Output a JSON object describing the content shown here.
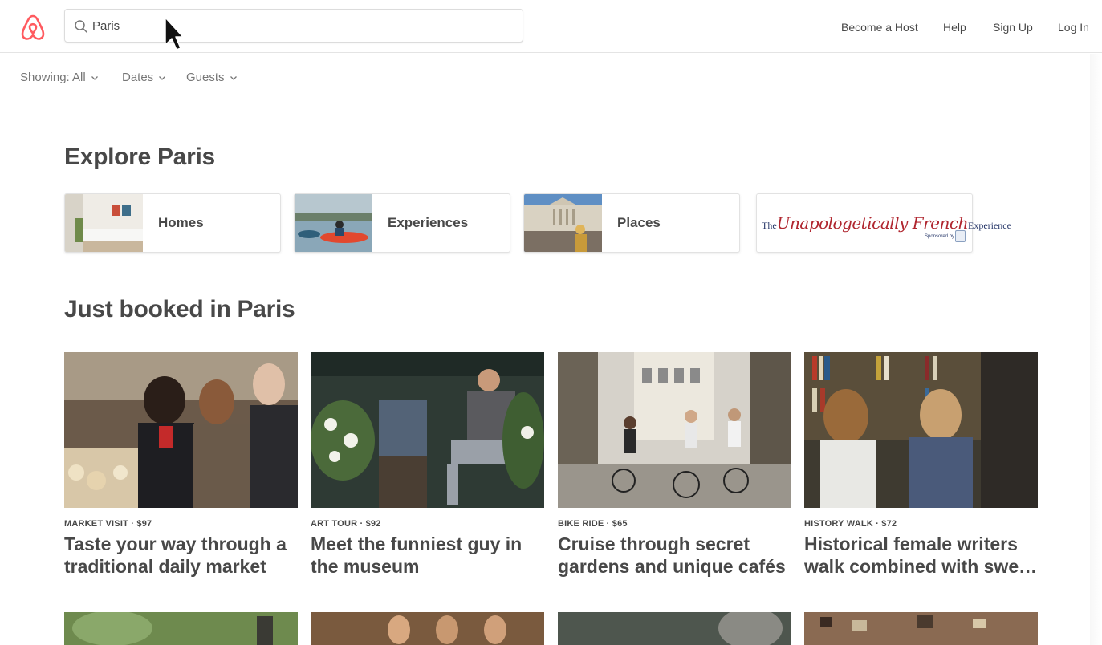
{
  "header": {
    "search": {
      "value": "Paris",
      "placeholder": ""
    },
    "nav": [
      "Become a Host",
      "Help",
      "Sign Up",
      "Log In"
    ]
  },
  "filters": [
    {
      "label": "Showing: All"
    },
    {
      "label": "Dates"
    },
    {
      "label": "Guests"
    }
  ],
  "explore": {
    "title": "Explore Paris",
    "tiles": [
      {
        "label": "Homes"
      },
      {
        "label": "Experiences"
      },
      {
        "label": "Places"
      }
    ],
    "sponsor": {
      "prefix": "The",
      "main": "Unapologetically French",
      "suffix": "Experience",
      "byline": "Sponsored by"
    }
  },
  "just_booked": {
    "title": "Just booked in Paris",
    "cards": [
      {
        "meta": "MARKET VISIT · $97",
        "title": "Taste your way through a traditional daily market"
      },
      {
        "meta": "ART TOUR · $92",
        "title": "Meet the funniest guy in the museum"
      },
      {
        "meta": "BIKE RIDE · $65",
        "title": "Cruise through secret gardens and unique cafés"
      },
      {
        "meta": "HISTORY WALK · $72",
        "title": "Historical female writers walk combined with swe…"
      }
    ]
  },
  "colors": {
    "brand": "#ff5a5f",
    "text": "#484848",
    "muted": "#767676",
    "border": "#e4e4e4"
  }
}
